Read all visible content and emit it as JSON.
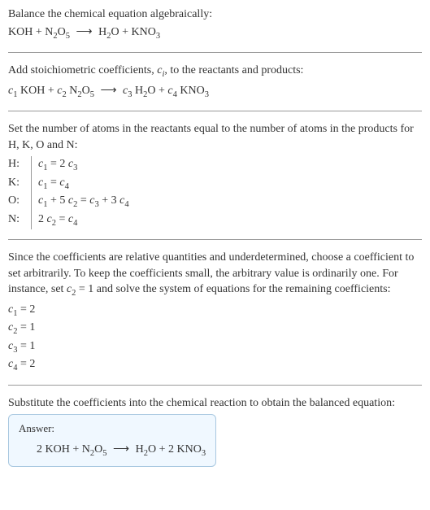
{
  "section1": {
    "intro": "Balance the chemical equation algebraically:",
    "eq_lhs1": "KOH",
    "eq_lhs2_a": "N",
    "eq_lhs2_sub1": "2",
    "eq_lhs2_b": "O",
    "eq_lhs2_sub2": "5",
    "eq_rhs1_a": "H",
    "eq_rhs1_sub": "2",
    "eq_rhs1_b": "O",
    "eq_rhs2_a": "KNO",
    "eq_rhs2_sub": "3"
  },
  "section2": {
    "intro_a": "Add stoichiometric coefficients, ",
    "intro_ci": "c",
    "intro_ci_sub": "i",
    "intro_b": ", to the reactants and products:",
    "c1": "c",
    "c1_sub": "1",
    "sp1": " KOH",
    "c2": "c",
    "c2_sub": "2",
    "sp2a": " N",
    "sp2sub1": "2",
    "sp2b": "O",
    "sp2sub2": "5",
    "c3": "c",
    "c3_sub": "3",
    "sp3a": " H",
    "sp3sub": "2",
    "sp3b": "O",
    "c4": "c",
    "c4_sub": "4",
    "sp4a": " KNO",
    "sp4sub": "3"
  },
  "section3": {
    "intro": "Set the number of atoms in the reactants equal to the number of atoms in the products for H, K, O and N:",
    "rows": {
      "H_label": "H:",
      "H_eq_a": "c",
      "H_eq_a_sub": "1",
      "H_eq_mid": " = 2 ",
      "H_eq_b": "c",
      "H_eq_b_sub": "3",
      "K_label": "K:",
      "K_eq_a": "c",
      "K_eq_a_sub": "1",
      "K_eq_mid": " = ",
      "K_eq_b": "c",
      "K_eq_b_sub": "4",
      "O_label": "O:",
      "O_eq_a": "c",
      "O_eq_a_sub": "1",
      "O_eq_mid1": " + 5 ",
      "O_eq_b": "c",
      "O_eq_b_sub": "2",
      "O_eq_mid2": " = ",
      "O_eq_c": "c",
      "O_eq_c_sub": "3",
      "O_eq_mid3": " + 3 ",
      "O_eq_d": "c",
      "O_eq_d_sub": "4",
      "N_label": "N:",
      "N_eq_pre": "2 ",
      "N_eq_a": "c",
      "N_eq_a_sub": "2",
      "N_eq_mid": " = ",
      "N_eq_b": "c",
      "N_eq_b_sub": "4"
    }
  },
  "section4": {
    "intro_a": "Since the coefficients are relative quantities and underdetermined, choose a coefficient to set arbitrarily. To keep the coefficients small, the arbitrary value is ordinarily one. For instance, set ",
    "intro_c": "c",
    "intro_c_sub": "2",
    "intro_b": " = 1 and solve the system of equations for the remaining coefficients:",
    "c1_lhs": "c",
    "c1_sub": "1",
    "c1_rhs": " = 2",
    "c2_lhs": "c",
    "c2_sub": "2",
    "c2_rhs": " = 1",
    "c3_lhs": "c",
    "c3_sub": "3",
    "c3_rhs": " = 1",
    "c4_lhs": "c",
    "c4_sub": "4",
    "c4_rhs": " = 2"
  },
  "section5": {
    "intro": "Substitute the coefficients into the chemical reaction to obtain the balanced equation:",
    "answer_label": "Answer:",
    "eq_lhs1": "2 KOH",
    "eq_lhs2_a": "N",
    "eq_lhs2_sub1": "2",
    "eq_lhs2_b": "O",
    "eq_lhs2_sub2": "5",
    "eq_rhs1_a": "H",
    "eq_rhs1_sub": "2",
    "eq_rhs1_b": "O",
    "eq_rhs2": "2 KNO",
    "eq_rhs2_sub": "3"
  },
  "arrow": "⟶",
  "plus": " + "
}
